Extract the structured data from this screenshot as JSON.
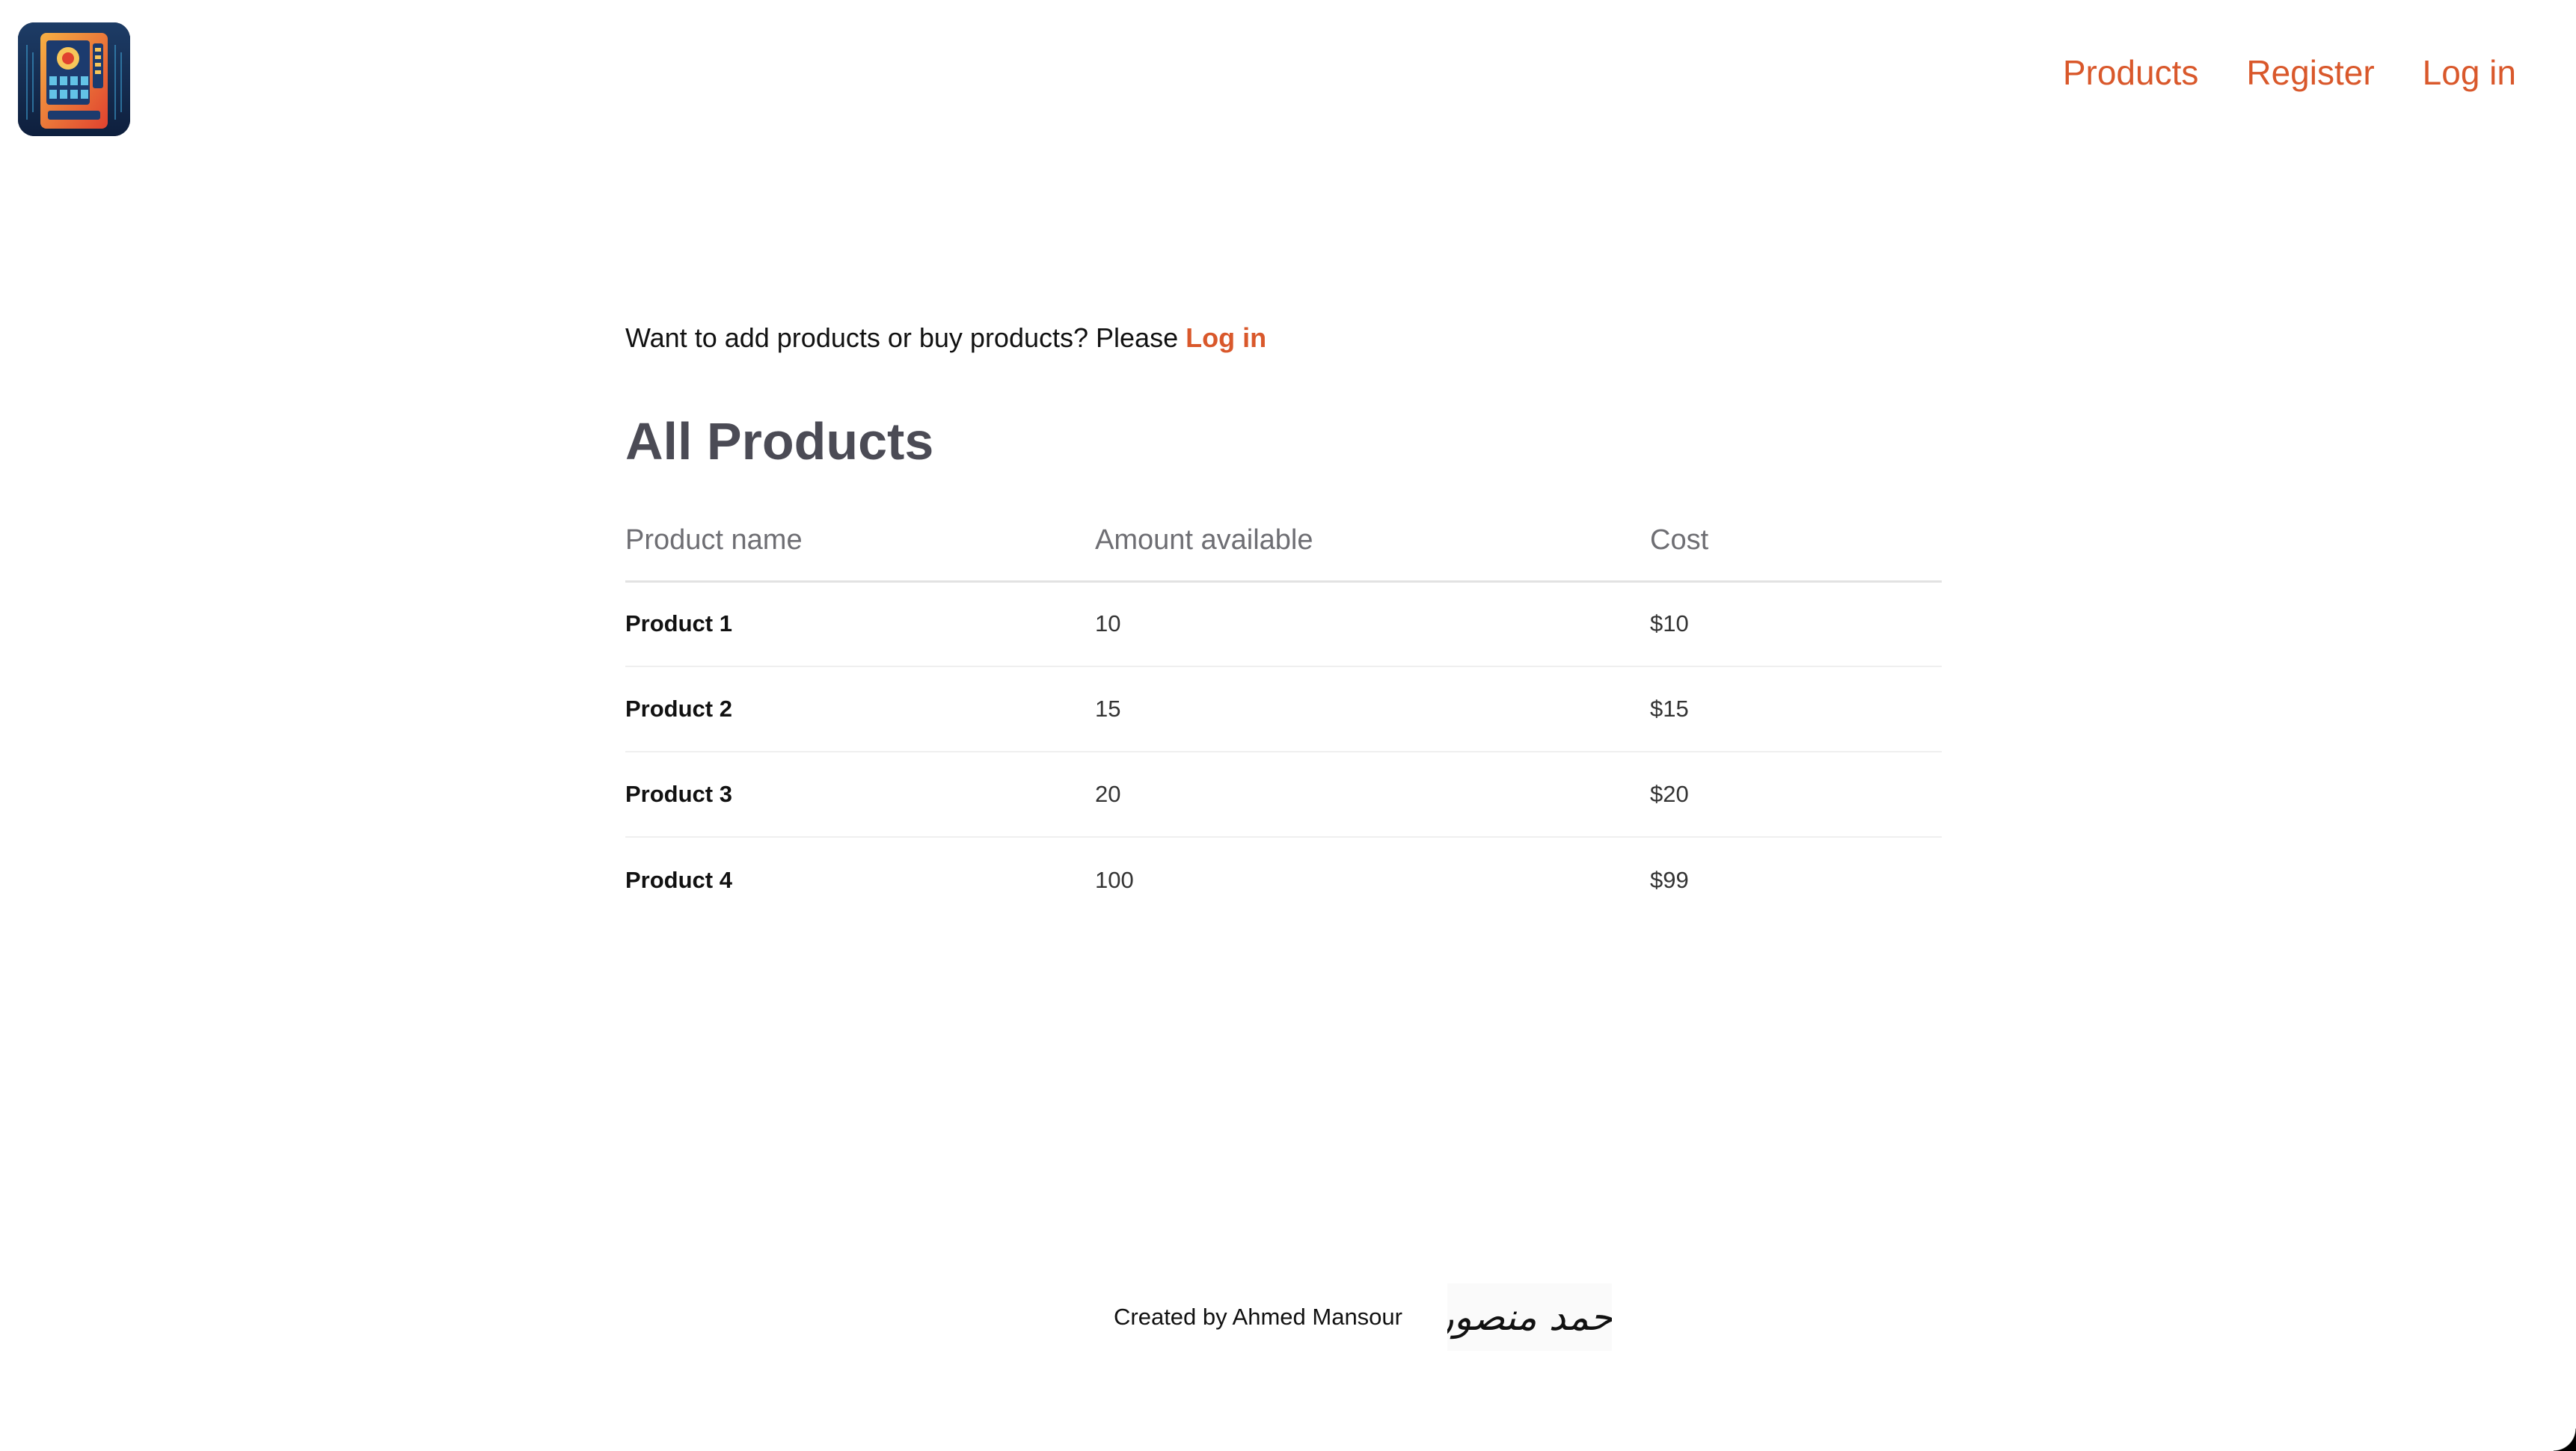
{
  "header": {
    "logo_icon": "vending-machine-icon",
    "nav": {
      "products": "Products",
      "register": "Register",
      "login": "Log in"
    }
  },
  "main": {
    "prompt_text": "Want to add products or buy products? Please ",
    "prompt_link": "Log in",
    "title": "All Products",
    "table": {
      "columns": [
        "Product name",
        "Amount available",
        "Cost"
      ],
      "rows": [
        [
          "Product 1",
          "10",
          "$10"
        ],
        [
          "Product 2",
          "15",
          "$15"
        ],
        [
          "Product 3",
          "20",
          "$20"
        ],
        [
          "Product 4",
          "100",
          "$99"
        ]
      ]
    }
  },
  "footer": {
    "credit": "Created by Ahmed Mansour",
    "signature": "أحمد منصور"
  },
  "colors": {
    "accent": "#d9582b",
    "title": "#4b4b55",
    "header_text": "#6e6e73"
  }
}
